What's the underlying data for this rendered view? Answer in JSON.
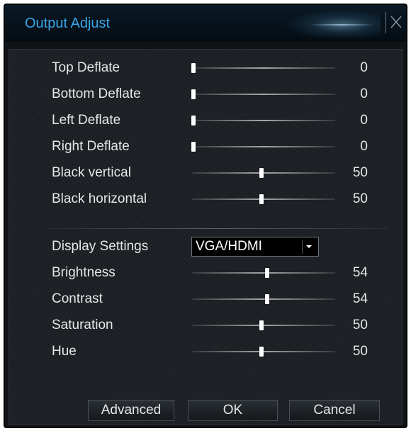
{
  "dialog": {
    "title": "Output Adjust"
  },
  "adjustments": [
    {
      "label": "Top Deflate",
      "value": 0,
      "level": 0
    },
    {
      "label": "Bottom Deflate",
      "value": 0,
      "level": 0
    },
    {
      "label": "Left Deflate",
      "value": 0,
      "level": 0
    },
    {
      "label": "Right Deflate",
      "value": 0,
      "level": 0
    },
    {
      "label": "Black vertical",
      "value": 50,
      "level": 0.5
    },
    {
      "label": "Black horizontal",
      "value": 50,
      "level": 0.5
    }
  ],
  "display": {
    "label": "Display Settings",
    "selected": "VGA/HDMI"
  },
  "picture": [
    {
      "label": "Brightness",
      "value": 54,
      "level": 0.54
    },
    {
      "label": "Contrast",
      "value": 54,
      "level": 0.54
    },
    {
      "label": "Saturation",
      "value": 50,
      "level": 0.5
    },
    {
      "label": "Hue",
      "value": 50,
      "level": 0.5
    }
  ],
  "buttons": {
    "advanced": "Advanced",
    "ok": "OK",
    "cancel": "Cancel"
  },
  "colors": {
    "title": "#3aa6e8",
    "text": "#e6e6e6",
    "thumb": "#ffffff"
  }
}
